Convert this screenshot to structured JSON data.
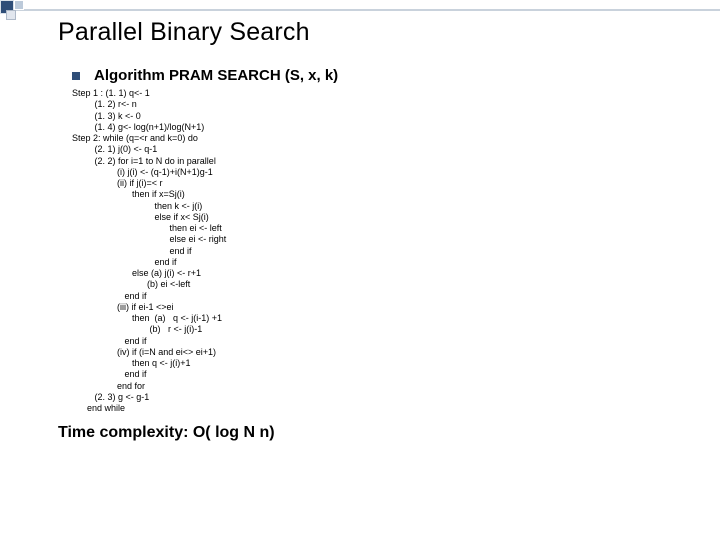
{
  "deco": {},
  "title": "Parallel Binary Search",
  "bullet": {
    "label": "Algorithm PRAM SEARCH (S, x, k)"
  },
  "algo_text": "Step 1 : (1. 1) q<- 1\n         (1. 2) r<- n\n         (1. 3) k <- 0\n         (1. 4) g<- log(n+1)/log(N+1)\nStep 2: while (q=<r and k=0) do\n         (2. 1) j(0) <- q-1\n         (2. 2) for i=1 to N do in parallel\n                  (i) j(i) <- (q-1)+i(N+1)g-1\n                  (ii) if j(i)=< r\n                        then if x=Sj(i)\n                                 then k <- j(i)\n                                 else if x< Sj(i)\n                                       then ei <- left\n                                       else ei <- right\n                                       end if\n                                 end if\n                        else (a) j(i) <- r+1\n                              (b) ei <-left\n                     end if\n                  (iii) if ei-1 <>ei\n                        then  (a)   q <- j(i-1) +1\n                               (b)   r <- j(i)-1\n                     end if\n                  (iv) if (i=N and ei<> ei+1)\n                        then q <- j(i)+1\n                     end if\n                  end for\n         (2. 3) g <- g-1\n      end while",
  "footer": "Time complexity:  O( log N n)"
}
